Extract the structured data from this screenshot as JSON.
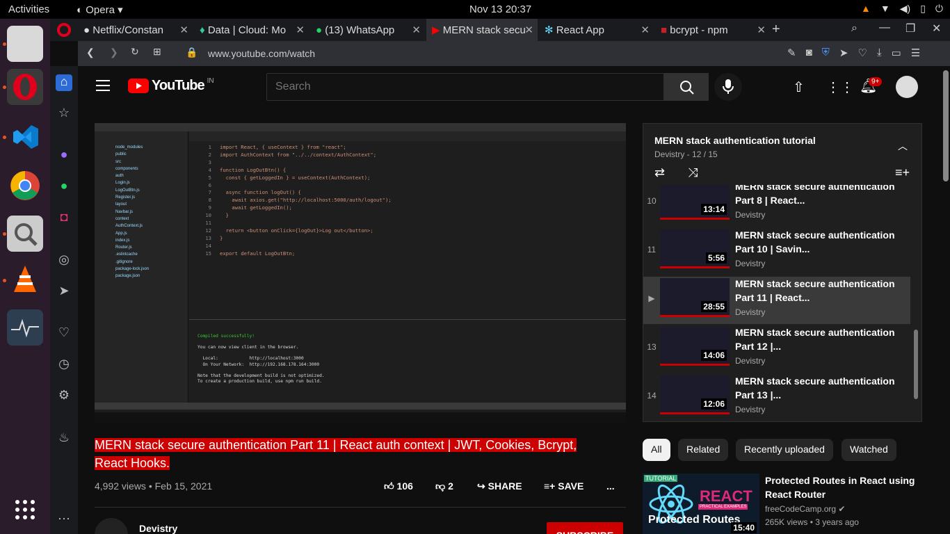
{
  "topbar": {
    "activities": "Activities",
    "app": "Opera",
    "clock": "Nov 13  20:37"
  },
  "tabs": [
    {
      "label": "Netflix/Constan"
    },
    {
      "label": "Data | Cloud: Mo"
    },
    {
      "label": "(13) WhatsApp"
    },
    {
      "label": "MERN stack secu"
    },
    {
      "label": "React App"
    },
    {
      "label": "bcrypt - npm"
    }
  ],
  "address": {
    "url": "www.youtube.com/watch"
  },
  "youtube": {
    "logo": "YouTube",
    "region": "IN",
    "search_placeholder": "Search",
    "notif_count": "9+"
  },
  "video": {
    "title": "MERN stack secure authentication Part 11 | React auth context | JWT, Cookies, Bcrypt, React Hooks.",
    "views": "4,992 views",
    "date": "Feb 15, 2021",
    "likes": "106",
    "dislikes": "2",
    "share": "SHARE",
    "save": "SAVE",
    "more": "...",
    "channel": "Devistry",
    "subscribe": "SUBSCRIBE"
  },
  "playlist": {
    "title": "MERN stack authentication tutorial",
    "channel": "Devistry",
    "position": "12 / 15",
    "items": [
      {
        "num": "10",
        "title": "MERN stack secure authentication Part 8 | React...",
        "channel": "Devistry",
        "duration": "13:14",
        "current": false
      },
      {
        "num": "11",
        "title": "MERN stack secure authentication Part 10 | Savin...",
        "channel": "Devistry",
        "duration": "5:56",
        "current": false
      },
      {
        "num": "",
        "title": "MERN stack secure authentication Part 11 | React...",
        "channel": "Devistry",
        "duration": "28:55",
        "current": true
      },
      {
        "num": "13",
        "title": "MERN stack secure authentication Part 12 |...",
        "channel": "Devistry",
        "duration": "14:06",
        "current": false
      },
      {
        "num": "14",
        "title": "MERN stack secure authentication Part 13 |...",
        "channel": "Devistry",
        "duration": "12:06",
        "current": false
      }
    ]
  },
  "chips": [
    "All",
    "Related",
    "Recently uploaded",
    "Watched"
  ],
  "recommended": {
    "title": "Protected Routes in React using React Router",
    "channel": "freeCodeCamp.org",
    "views": "265K views",
    "age": "3 years ago",
    "duration": "15:40",
    "thumb_badge": "TUTORIAL",
    "thumb_heading": "REACT",
    "thumb_sub": "PRACTICAL EXAMPLES",
    "thumb_caption": "Protected Routes"
  },
  "editor": {
    "lines": [
      {
        "n": "1",
        "t": "import React, { useContext } from \"react\";"
      },
      {
        "n": "2",
        "t": "import AuthContext from \"../../context/AuthContext\";"
      },
      {
        "n": "3",
        "t": ""
      },
      {
        "n": "4",
        "t": "function LogOutBtn() {"
      },
      {
        "n": "5",
        "t": "  const { getLoggedIn } = useContext(AuthContext);"
      },
      {
        "n": "6",
        "t": ""
      },
      {
        "n": "7",
        "t": "  async function logOut() {"
      },
      {
        "n": "8",
        "t": "    await axios.get(\"http://localhost:5000/auth/logout\");"
      },
      {
        "n": "9",
        "t": "    await getLoggedIn();"
      },
      {
        "n": "10",
        "t": "  }"
      },
      {
        "n": "11",
        "t": ""
      },
      {
        "n": "12",
        "t": "  return <button onClick={logOut}>Log out</button>;"
      },
      {
        "n": "13",
        "t": "}"
      },
      {
        "n": "14",
        "t": ""
      },
      {
        "n": "15",
        "t": "export default LogOutBtn;"
      }
    ],
    "terminal": [
      "Compiled successfully!",
      "",
      "You can now view client in the browser.",
      "",
      "  Local:            http://localhost:3000",
      "  On Your Network:  http://192.168.178.164:3000",
      "",
      "Note that the development build is not optimized.",
      "To create a production build, use npm run build."
    ],
    "files": [
      "node_modules",
      "public",
      "src",
      "components",
      "auth",
      "Login.js",
      "LogOutBtn.js",
      "Register.js",
      "layout",
      "Navbar.js",
      "context",
      "AuthContext.js",
      "App.js",
      "index.js",
      "Router.js",
      ".eslintcache",
      ".gitignore",
      "package-lock.json",
      "package.json"
    ]
  },
  "colors": {
    "accent": "#cc0000",
    "bg": "#0f0f0f",
    "panel": "#1f1f1f"
  }
}
